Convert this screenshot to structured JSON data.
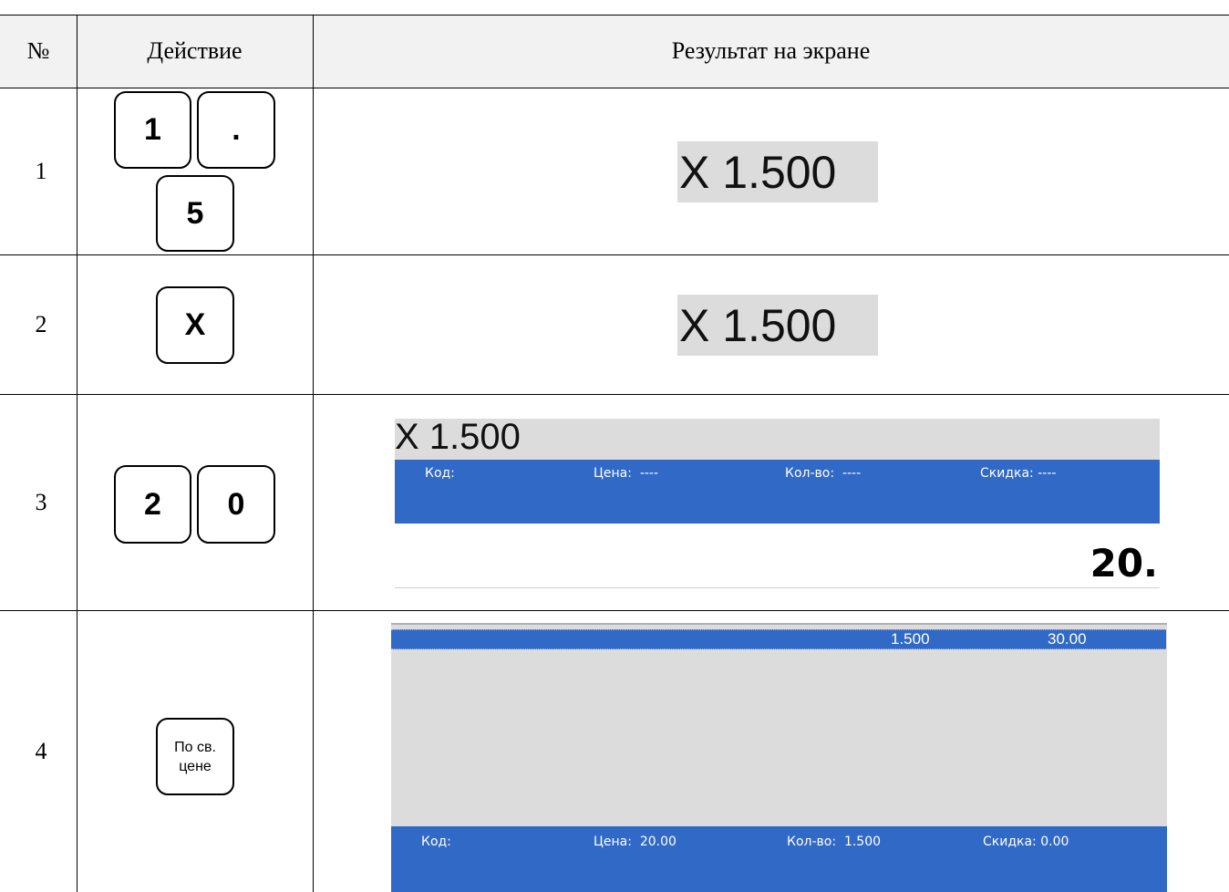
{
  "header": {
    "num": "№",
    "action": "Действие",
    "result": "Результат на экране"
  },
  "rows": [
    {
      "num": "1",
      "keys": [
        "1",
        ".",
        "5"
      ],
      "screen": {
        "quantity": "X 1.500"
      }
    },
    {
      "num": "2",
      "keys": [
        "X"
      ],
      "screen": {
        "quantity": "X 1.500"
      }
    },
    {
      "num": "3",
      "keys": [
        "2",
        "0"
      ],
      "screen": {
        "quantity": "X 1.500",
        "bar": {
          "code": "Код:",
          "price": "Цена:  ----",
          "qty": "Кол-во:  ----",
          "discount": "Скидка: ----"
        },
        "entry": "20."
      }
    },
    {
      "num": "4",
      "keys": [
        "По св.",
        "цене"
      ],
      "screen": {
        "row": {
          "qty": "1.500",
          "sum": "30.00"
        },
        "bar": {
          "code": "Код:",
          "price": "Цена:  20.00",
          "qty": "Кол-во:  1.500",
          "discount": "Скидка: 0.00"
        }
      }
    }
  ],
  "colors": {
    "key_border": "#000000",
    "status_bar": "#3169c6",
    "screen_bg": "#dcdcdc",
    "header_bg": "#f2f2f2"
  }
}
